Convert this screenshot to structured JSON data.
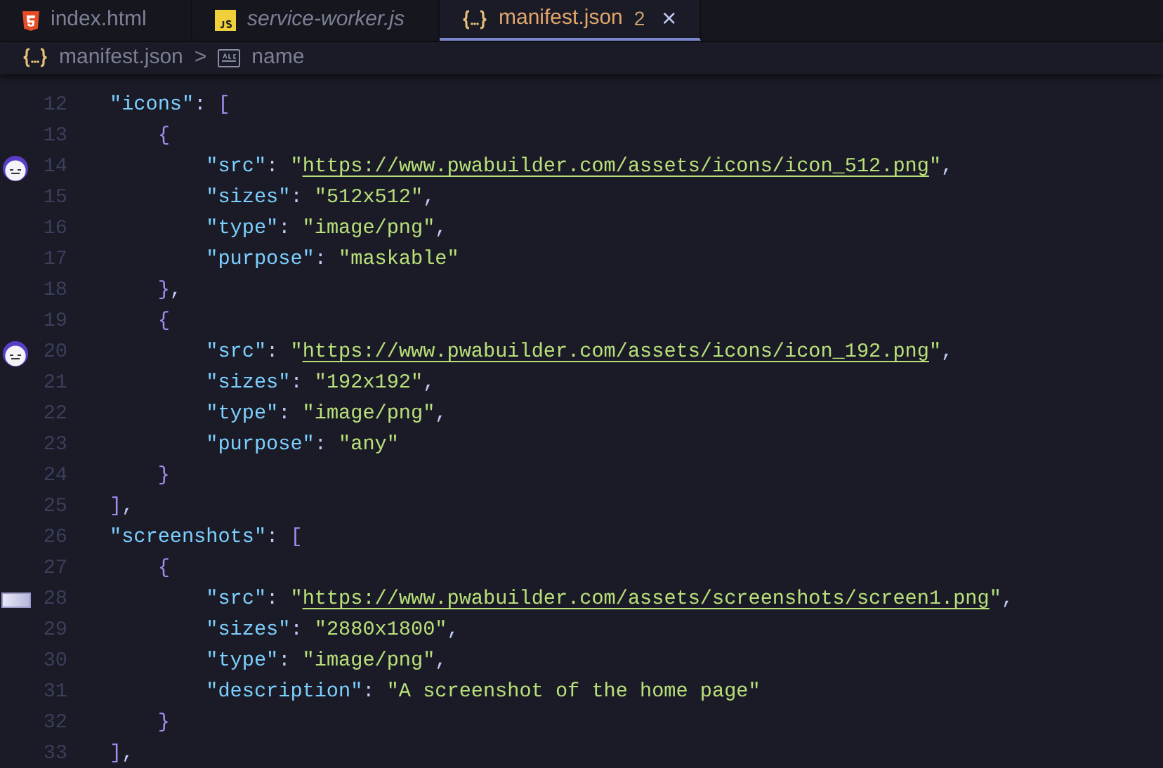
{
  "tabs": [
    {
      "label": "index.html",
      "kind": "html",
      "italic": false,
      "selected": false
    },
    {
      "label": "service-worker.js",
      "kind": "js",
      "italic": true,
      "selected": false
    },
    {
      "label": "manifest.json",
      "kind": "json",
      "italic": false,
      "selected": true,
      "problems": "2",
      "close": "×"
    }
  ],
  "breadcrumb": [
    {
      "label": "manifest.json",
      "kind": "json"
    },
    {
      "label": "name",
      "kind": "string"
    }
  ],
  "breadcrumb_separator": ">",
  "lines": [
    {
      "number": "12",
      "tokens": [
        {
          "kind": "key",
          "text": "\"icons\""
        },
        {
          "kind": "punct",
          "text": ": "
        },
        {
          "kind": "bracket",
          "text": "["
        }
      ]
    },
    {
      "number": "13",
      "tokens": [
        {
          "kind": "bracket",
          "text": "    {"
        }
      ]
    },
    {
      "number": "14",
      "marker": {
        "kind": "avatar"
      },
      "tokens": [
        {
          "kind": "key",
          "text": "        \"src\""
        },
        {
          "kind": "punct",
          "text": ": "
        },
        {
          "kind": "string",
          "text": "\""
        },
        {
          "kind": "url",
          "text": "https://www.pwabuilder.com/assets/icons/icon_512.png"
        },
        {
          "kind": "string",
          "text": "\""
        },
        {
          "kind": "punct",
          "text": ","
        }
      ]
    },
    {
      "number": "15",
      "tokens": [
        {
          "kind": "key",
          "text": "        \"sizes\""
        },
        {
          "kind": "punct",
          "text": ": "
        },
        {
          "kind": "string",
          "text": "\"512x512\""
        },
        {
          "kind": "punct",
          "text": ","
        }
      ]
    },
    {
      "number": "16",
      "tokens": [
        {
          "kind": "key",
          "text": "        \"type\""
        },
        {
          "kind": "punct",
          "text": ": "
        },
        {
          "kind": "string",
          "text": "\"image/png\""
        },
        {
          "kind": "punct",
          "text": ","
        }
      ]
    },
    {
      "number": "17",
      "tokens": [
        {
          "kind": "key",
          "text": "        \"purpose\""
        },
        {
          "kind": "punct",
          "text": ": "
        },
        {
          "kind": "string",
          "text": "\"maskable\""
        }
      ]
    },
    {
      "number": "18",
      "tokens": [
        {
          "kind": "bracket",
          "text": "    }"
        },
        {
          "kind": "punct",
          "text": ","
        }
      ]
    },
    {
      "number": "19",
      "tokens": [
        {
          "kind": "bracket",
          "text": "    {"
        }
      ]
    },
    {
      "number": "20",
      "marker": {
        "kind": "avatar"
      },
      "tokens": [
        {
          "kind": "key",
          "text": "        \"src\""
        },
        {
          "kind": "punct",
          "text": ": "
        },
        {
          "kind": "string",
          "text": "\""
        },
        {
          "kind": "url",
          "text": "https://www.pwabuilder.com/assets/icons/icon_192.png"
        },
        {
          "kind": "string",
          "text": "\""
        },
        {
          "kind": "punct",
          "text": ","
        }
      ]
    },
    {
      "number": "21",
      "tokens": [
        {
          "kind": "key",
          "text": "        \"sizes\""
        },
        {
          "kind": "punct",
          "text": ": "
        },
        {
          "kind": "string",
          "text": "\"192x192\""
        },
        {
          "kind": "punct",
          "text": ","
        }
      ]
    },
    {
      "number": "22",
      "tokens": [
        {
          "kind": "key",
          "text": "        \"type\""
        },
        {
          "kind": "punct",
          "text": ": "
        },
        {
          "kind": "string",
          "text": "\"image/png\""
        },
        {
          "kind": "punct",
          "text": ","
        }
      ]
    },
    {
      "number": "23",
      "tokens": [
        {
          "kind": "key",
          "text": "        \"purpose\""
        },
        {
          "kind": "punct",
          "text": ": "
        },
        {
          "kind": "string",
          "text": "\"any\""
        }
      ]
    },
    {
      "number": "24",
      "tokens": [
        {
          "kind": "bracket",
          "text": "    }"
        }
      ]
    },
    {
      "number": "25",
      "tokens": [
        {
          "kind": "bracket",
          "text": "]"
        },
        {
          "kind": "punct",
          "text": ","
        }
      ]
    },
    {
      "number": "26",
      "tokens": [
        {
          "kind": "key",
          "text": "\"screenshots\""
        },
        {
          "kind": "punct",
          "text": ": "
        },
        {
          "kind": "bracket",
          "text": "["
        }
      ]
    },
    {
      "number": "27",
      "tokens": [
        {
          "kind": "bracket",
          "text": "    {"
        }
      ]
    },
    {
      "number": "28",
      "marker": {
        "kind": "thumbnail"
      },
      "tokens": [
        {
          "kind": "key",
          "text": "        \"src\""
        },
        {
          "kind": "punct",
          "text": ": "
        },
        {
          "kind": "string",
          "text": "\""
        },
        {
          "kind": "url",
          "text": "https://www.pwabuilder.com/assets/screenshots/screen1.png"
        },
        {
          "kind": "string",
          "text": "\""
        },
        {
          "kind": "punct",
          "text": ","
        }
      ]
    },
    {
      "number": "29",
      "tokens": [
        {
          "kind": "key",
          "text": "        \"sizes\""
        },
        {
          "kind": "punct",
          "text": ": "
        },
        {
          "kind": "string",
          "text": "\"2880x1800\""
        },
        {
          "kind": "punct",
          "text": ","
        }
      ]
    },
    {
      "number": "30",
      "tokens": [
        {
          "kind": "key",
          "text": "        \"type\""
        },
        {
          "kind": "punct",
          "text": ": "
        },
        {
          "kind": "string",
          "text": "\"image/png\""
        },
        {
          "kind": "punct",
          "text": ","
        }
      ]
    },
    {
      "number": "31",
      "tokens": [
        {
          "kind": "key",
          "text": "        \"description\""
        },
        {
          "kind": "punct",
          "text": ": "
        },
        {
          "kind": "string",
          "text": "\"A screenshot of the home page\""
        }
      ]
    },
    {
      "number": "32",
      "tokens": [
        {
          "kind": "bracket",
          "text": "    }"
        }
      ]
    },
    {
      "number": "33",
      "tokens": [
        {
          "kind": "bracket",
          "text": "]"
        },
        {
          "kind": "punct",
          "text": ","
        }
      ]
    }
  ]
}
